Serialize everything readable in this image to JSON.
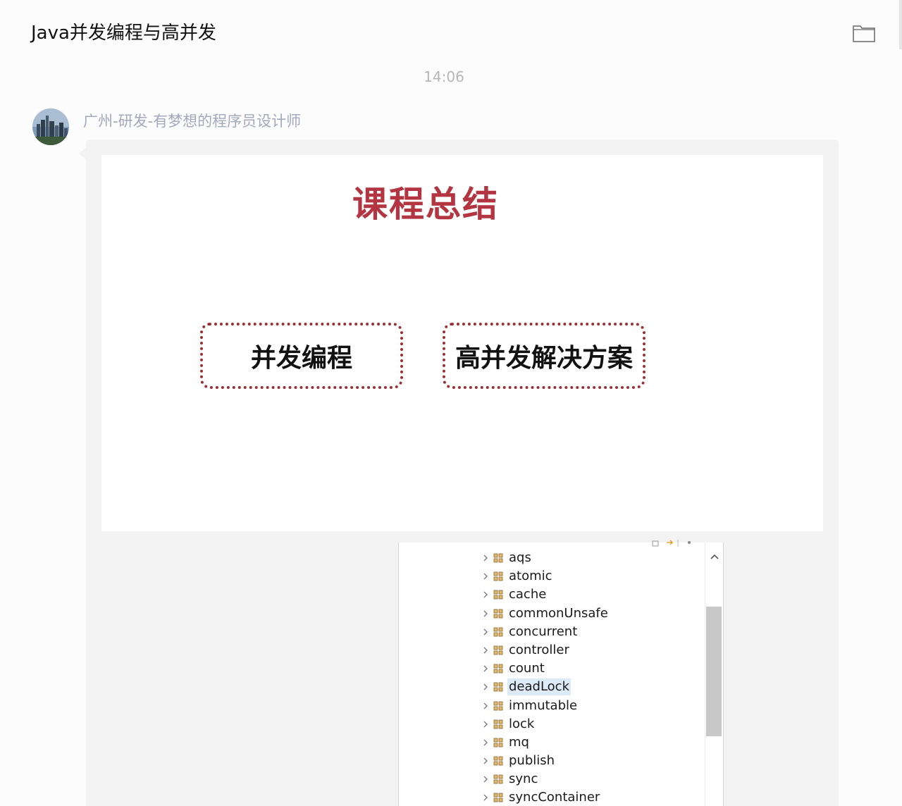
{
  "header": {
    "title": "Java并发编程与高并发",
    "folder_icon": "folder-icon"
  },
  "chat": {
    "timestamp": "14:06",
    "message": {
      "sender_name": "广州-研发-有梦想的程序员设计师",
      "avatar_icon": "city-skyline-avatar",
      "slide": {
        "title": "课程总结",
        "topics": [
          "并发编程",
          "高并发解决方案"
        ],
        "title_color": "#b23541",
        "border_color": "#9a2f34"
      },
      "package_tree": {
        "items": [
          {
            "label": "aqs",
            "selected": false
          },
          {
            "label": "atomic",
            "selected": false
          },
          {
            "label": "cache",
            "selected": false
          },
          {
            "label": "commonUnsafe",
            "selected": false
          },
          {
            "label": "concurrent",
            "selected": false
          },
          {
            "label": "controller",
            "selected": false
          },
          {
            "label": "count",
            "selected": false
          },
          {
            "label": "deadLock",
            "selected": true
          },
          {
            "label": "immutable",
            "selected": false
          },
          {
            "label": "lock",
            "selected": false
          },
          {
            "label": "mq",
            "selected": false
          },
          {
            "label": "publish",
            "selected": false
          },
          {
            "label": "sync",
            "selected": false
          },
          {
            "label": "syncContainer",
            "selected": false
          }
        ],
        "item_icon": "package-icon",
        "expand_icon": "chevron-right-icon"
      }
    }
  }
}
